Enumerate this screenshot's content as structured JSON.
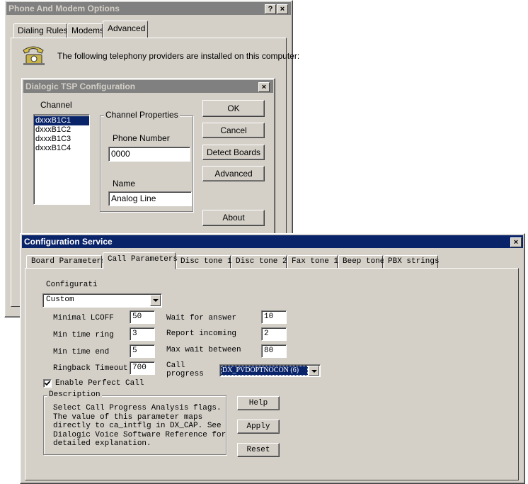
{
  "phone_modem": {
    "title": "Phone And Modem Options",
    "help_btn": "?",
    "close_btn": "×",
    "tabs": [
      "Dialing Rules",
      "Modems",
      "Advanced"
    ],
    "description": "The following telephony providers are installed on this computer:"
  },
  "tsp": {
    "title": "Dialogic TSP Configuration",
    "close_btn": "×",
    "channel_label": "Channel",
    "channels": [
      "dxxxB1C1",
      "dxxxB1C2",
      "dxxxB1C3",
      "dxxxB1C4"
    ],
    "group_label": "Channel Properties",
    "phone_number_label": "Phone Number",
    "phone_number_value": "0000",
    "name_label": "Name",
    "name_value": "Analog Line",
    "buttons": {
      "ok": "OK",
      "cancel": "Cancel",
      "detect": "Detect Boards",
      "advanced": "Advanced",
      "about": "About"
    }
  },
  "config": {
    "title": "Configuration Service",
    "close_btn": "×",
    "tabs": [
      "Board Parameters",
      "Call Parameters",
      "Disc tone 1",
      "Disc tone 2",
      "Fax tone 1",
      "Beep tone",
      "PBX strings"
    ],
    "configurati_label": "Configurati",
    "configurati_value": "Custom",
    "left_params": [
      {
        "label": "Minimal LCOFF",
        "value": "50"
      },
      {
        "label": "Min time ring",
        "value": "3"
      },
      {
        "label": "Min time end",
        "value": "5"
      },
      {
        "label": "Ringback Timeout",
        "value": "700"
      }
    ],
    "right_params": [
      {
        "label": "Wait for answer",
        "value": "10"
      },
      {
        "label": "Report incoming",
        "value": "2"
      },
      {
        "label": "Max wait between",
        "value": "80"
      }
    ],
    "call_progress_label_1": "Call",
    "call_progress_label_2": "progress",
    "call_progress_value": "DX_PVDOPTNOCON (6)",
    "enable_perfect_call": "Enable Perfect Call",
    "description_label": "Description",
    "description_text": "Select Call Progress Analysis flags.\nThe value of this parameter maps\ndirectly to ca_intflg in DX_CAP. See\nDialogic Voice Software Reference for\ndetailed explanation.",
    "buttons": {
      "help": "Help",
      "apply": "Apply",
      "reset": "Reset"
    }
  }
}
